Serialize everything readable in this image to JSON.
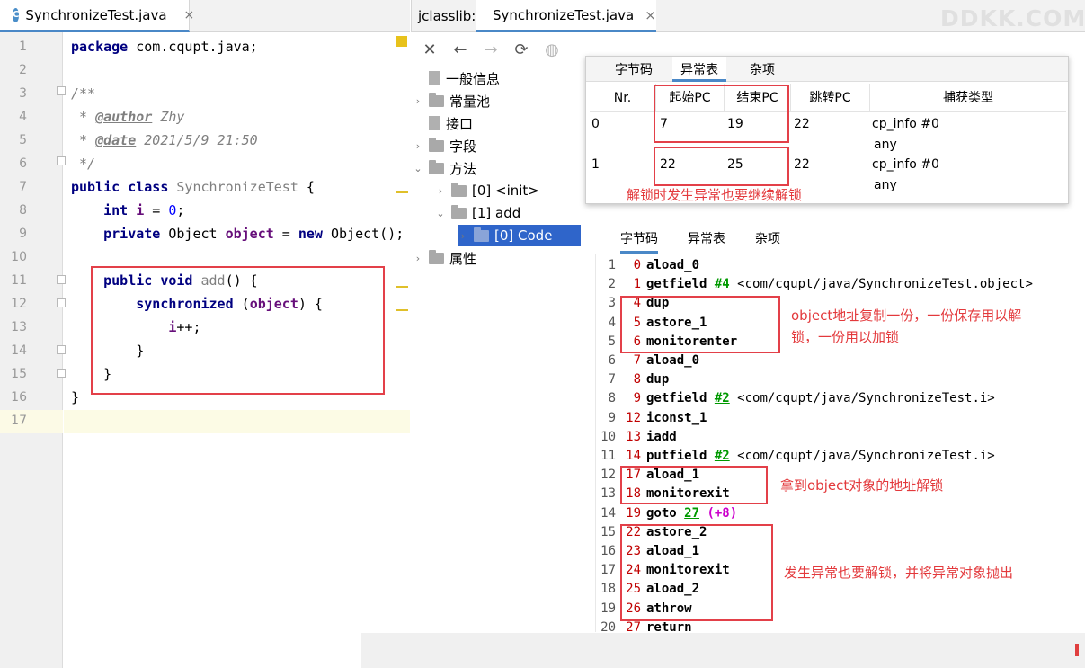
{
  "editor": {
    "tab_title": "SynchronizeTest.java",
    "tab_close": "×",
    "lines": [
      {
        "n": "1",
        "segments": [
          {
            "t": "package ",
            "c": "kw"
          },
          {
            "t": "com.cqupt.java;",
            "c": ""
          }
        ]
      },
      {
        "n": "2",
        "segments": []
      },
      {
        "n": "3",
        "segments": [
          {
            "t": "/**",
            "c": "cm"
          }
        ]
      },
      {
        "n": "4",
        "segments": [
          {
            "t": " * ",
            "c": "cm"
          },
          {
            "t": "@author",
            "c": "tag"
          },
          {
            "t": " Zhy",
            "c": "cm"
          }
        ]
      },
      {
        "n": "5",
        "segments": [
          {
            "t": " * ",
            "c": "cm"
          },
          {
            "t": "@date",
            "c": "tag"
          },
          {
            "t": " 2021/5/9 21:50",
            "c": "cm"
          }
        ]
      },
      {
        "n": "6",
        "segments": [
          {
            "t": " */",
            "c": "cm"
          }
        ]
      },
      {
        "n": "7",
        "segments": [
          {
            "t": "public class ",
            "c": "kw"
          },
          {
            "t": "SynchronizeTest",
            "c": "gry"
          },
          {
            "t": " {",
            "c": ""
          }
        ]
      },
      {
        "n": "8",
        "segments": [
          {
            "t": "    int ",
            "c": "kw"
          },
          {
            "t": "i",
            "c": "fld"
          },
          {
            "t": " = ",
            "c": ""
          },
          {
            "t": "0",
            "c": "num"
          },
          {
            "t": ";",
            "c": ""
          }
        ]
      },
      {
        "n": "9",
        "segments": [
          {
            "t": "    private ",
            "c": "kw"
          },
          {
            "t": "Object ",
            "c": ""
          },
          {
            "t": "object",
            "c": "fld"
          },
          {
            "t": " = ",
            "c": ""
          },
          {
            "t": "new ",
            "c": "kw"
          },
          {
            "t": "Object();",
            "c": ""
          }
        ]
      },
      {
        "n": "10",
        "segments": []
      },
      {
        "n": "11",
        "segments": [
          {
            "t": "    public void ",
            "c": "kw"
          },
          {
            "t": "add",
            "c": "gry"
          },
          {
            "t": "() {",
            "c": ""
          }
        ]
      },
      {
        "n": "12",
        "segments": [
          {
            "t": "        synchronized ",
            "c": "kw"
          },
          {
            "t": "(",
            "c": ""
          },
          {
            "t": "object",
            "c": "fld"
          },
          {
            "t": ") {",
            "c": ""
          }
        ]
      },
      {
        "n": "13",
        "segments": [
          {
            "t": "            ",
            "c": ""
          },
          {
            "t": "i",
            "c": "fld"
          },
          {
            "t": "++;",
            "c": ""
          }
        ]
      },
      {
        "n": "14",
        "segments": [
          {
            "t": "        }",
            "c": ""
          }
        ]
      },
      {
        "n": "15",
        "segments": [
          {
            "t": "    }",
            "c": ""
          }
        ]
      },
      {
        "n": "16",
        "segments": [
          {
            "t": "}",
            "c": ""
          }
        ]
      },
      {
        "n": "17",
        "segments": []
      }
    ]
  },
  "jclasslib": {
    "label": "jclasslib:",
    "tab_title": "SynchronizeTest.java",
    "tab_close": "×",
    "watermark": "DDKK.COM",
    "toolbar": {
      "close": "✕",
      "back": "←",
      "forward": "→",
      "refresh": "⟳",
      "web": "◍"
    },
    "tree": [
      {
        "label": "一般信息",
        "indent": 0,
        "arrow": "",
        "icon": "file"
      },
      {
        "label": "常量池",
        "indent": 0,
        "arrow": "›",
        "icon": "folder"
      },
      {
        "label": "接口",
        "indent": 0,
        "arrow": "",
        "icon": "file"
      },
      {
        "label": "字段",
        "indent": 0,
        "arrow": "›",
        "icon": "folder"
      },
      {
        "label": "方法",
        "indent": 0,
        "arrow": "⌄",
        "icon": "folder"
      },
      {
        "label": "[0] <init>",
        "indent": 1,
        "arrow": "›",
        "icon": "folder"
      },
      {
        "label": "[1] add",
        "indent": 1,
        "arrow": "⌄",
        "icon": "folder"
      },
      {
        "label": "[0] Code",
        "indent": 2,
        "arrow": "›",
        "icon": "folder",
        "selected": true
      },
      {
        "label": "属性",
        "indent": 0,
        "arrow": "›",
        "icon": "folder"
      }
    ],
    "exception_popup": {
      "tabs": [
        "字节码",
        "异常表",
        "杂项"
      ],
      "active_tab": 1,
      "headers": [
        "Nr.",
        "起始PC",
        "结束PC",
        "跳转PC",
        "捕获类型"
      ],
      "rows": [
        {
          "nr": "0",
          "start": "7",
          "end": "19",
          "handler": "22",
          "type": "cp_info #0",
          "type2": "any"
        },
        {
          "nr": "1",
          "start": "22",
          "end": "25",
          "handler": "22",
          "type": "cp_info #0",
          "type2": "any"
        }
      ],
      "note": "解锁时发生异常也要继续解锁"
    },
    "bytecode": {
      "tabs": [
        "字节码",
        "异常表",
        "杂项"
      ],
      "active_tab": 0,
      "lines": [
        {
          "n": "1",
          "off": "0",
          "op": "aload_0",
          "ref": "",
          "rest": "",
          "rel": ""
        },
        {
          "n": "2",
          "off": "1",
          "op": "getfield",
          "ref": "#4",
          "rest": " <com/cqupt/java/SynchronizeTest.object>",
          "rel": ""
        },
        {
          "n": "3",
          "off": "4",
          "op": "dup",
          "ref": "",
          "rest": "",
          "rel": ""
        },
        {
          "n": "4",
          "off": "5",
          "op": "astore_1",
          "ref": "",
          "rest": "",
          "rel": ""
        },
        {
          "n": "5",
          "off": "6",
          "op": "monitorenter",
          "ref": "",
          "rest": "",
          "rel": ""
        },
        {
          "n": "6",
          "off": "7",
          "op": "aload_0",
          "ref": "",
          "rest": "",
          "rel": ""
        },
        {
          "n": "7",
          "off": "8",
          "op": "dup",
          "ref": "",
          "rest": "",
          "rel": ""
        },
        {
          "n": "8",
          "off": "9",
          "op": "getfield",
          "ref": "#2",
          "rest": " <com/cqupt/java/SynchronizeTest.i>",
          "rel": ""
        },
        {
          "n": "9",
          "off": "12",
          "op": "iconst_1",
          "ref": "",
          "rest": "",
          "rel": ""
        },
        {
          "n": "10",
          "off": "13",
          "op": "iadd",
          "ref": "",
          "rest": "",
          "rel": ""
        },
        {
          "n": "11",
          "off": "14",
          "op": "putfield",
          "ref": "#2",
          "rest": " <com/cqupt/java/SynchronizeTest.i>",
          "rel": ""
        },
        {
          "n": "12",
          "off": "17",
          "op": "aload_1",
          "ref": "",
          "rest": "",
          "rel": ""
        },
        {
          "n": "13",
          "off": "18",
          "op": "monitorexit",
          "ref": "",
          "rest": "",
          "rel": ""
        },
        {
          "n": "14",
          "off": "19",
          "op": "goto",
          "ref": "27",
          "rest": " ",
          "rel": "(+8)"
        },
        {
          "n": "15",
          "off": "22",
          "op": "astore_2",
          "ref": "",
          "rest": "",
          "rel": ""
        },
        {
          "n": "16",
          "off": "23",
          "op": "aload_1",
          "ref": "",
          "rest": "",
          "rel": ""
        },
        {
          "n": "17",
          "off": "24",
          "op": "monitorexit",
          "ref": "",
          "rest": "",
          "rel": ""
        },
        {
          "n": "18",
          "off": "25",
          "op": "aload_2",
          "ref": "",
          "rest": "",
          "rel": ""
        },
        {
          "n": "19",
          "off": "26",
          "op": "athrow",
          "ref": "",
          "rest": "",
          "rel": ""
        },
        {
          "n": "20",
          "off": "27",
          "op": "return",
          "ref": "",
          "rest": "",
          "rel": ""
        }
      ],
      "notes": {
        "copy_line1": "object地址复制一份，一份保存用以解",
        "copy_line2": "锁，一份用以加锁",
        "unlock": "拿到object对象的地址解锁",
        "exception": "发生异常也要解锁，并将异常对象抛出"
      }
    }
  }
}
